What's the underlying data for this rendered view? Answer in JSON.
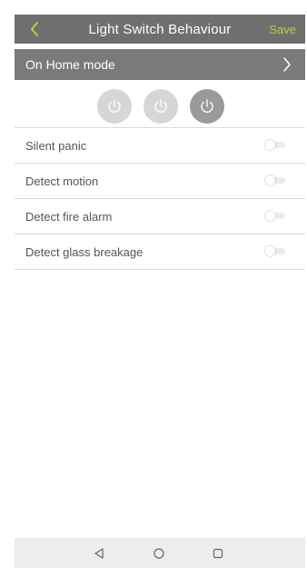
{
  "header": {
    "title": "Light Switch Behaviour",
    "save_label": "Save",
    "back_icon": "chevron-left-icon"
  },
  "mode": {
    "label": "On Home mode",
    "chevron_icon": "chevron-right-icon"
  },
  "switches": [
    {
      "name": "power-icon",
      "state": "off"
    },
    {
      "name": "power-icon",
      "state": "off"
    },
    {
      "name": "power-icon",
      "state": "on"
    }
  ],
  "settings": [
    {
      "label": "Silent panic",
      "enabled": false
    },
    {
      "label": "Detect motion",
      "enabled": false
    },
    {
      "label": "Detect fire alarm",
      "enabled": false
    },
    {
      "label": "Detect glass breakage",
      "enabled": false
    }
  ],
  "navigation": {
    "back": "triangle-back-icon",
    "home": "circle-home-icon",
    "recents": "square-recents-icon"
  },
  "colors": {
    "header_bg": "#6f6f6f",
    "mode_bar_bg": "#7a7a7a",
    "accent": "#b7d23b",
    "nav_bg": "#ededed"
  }
}
